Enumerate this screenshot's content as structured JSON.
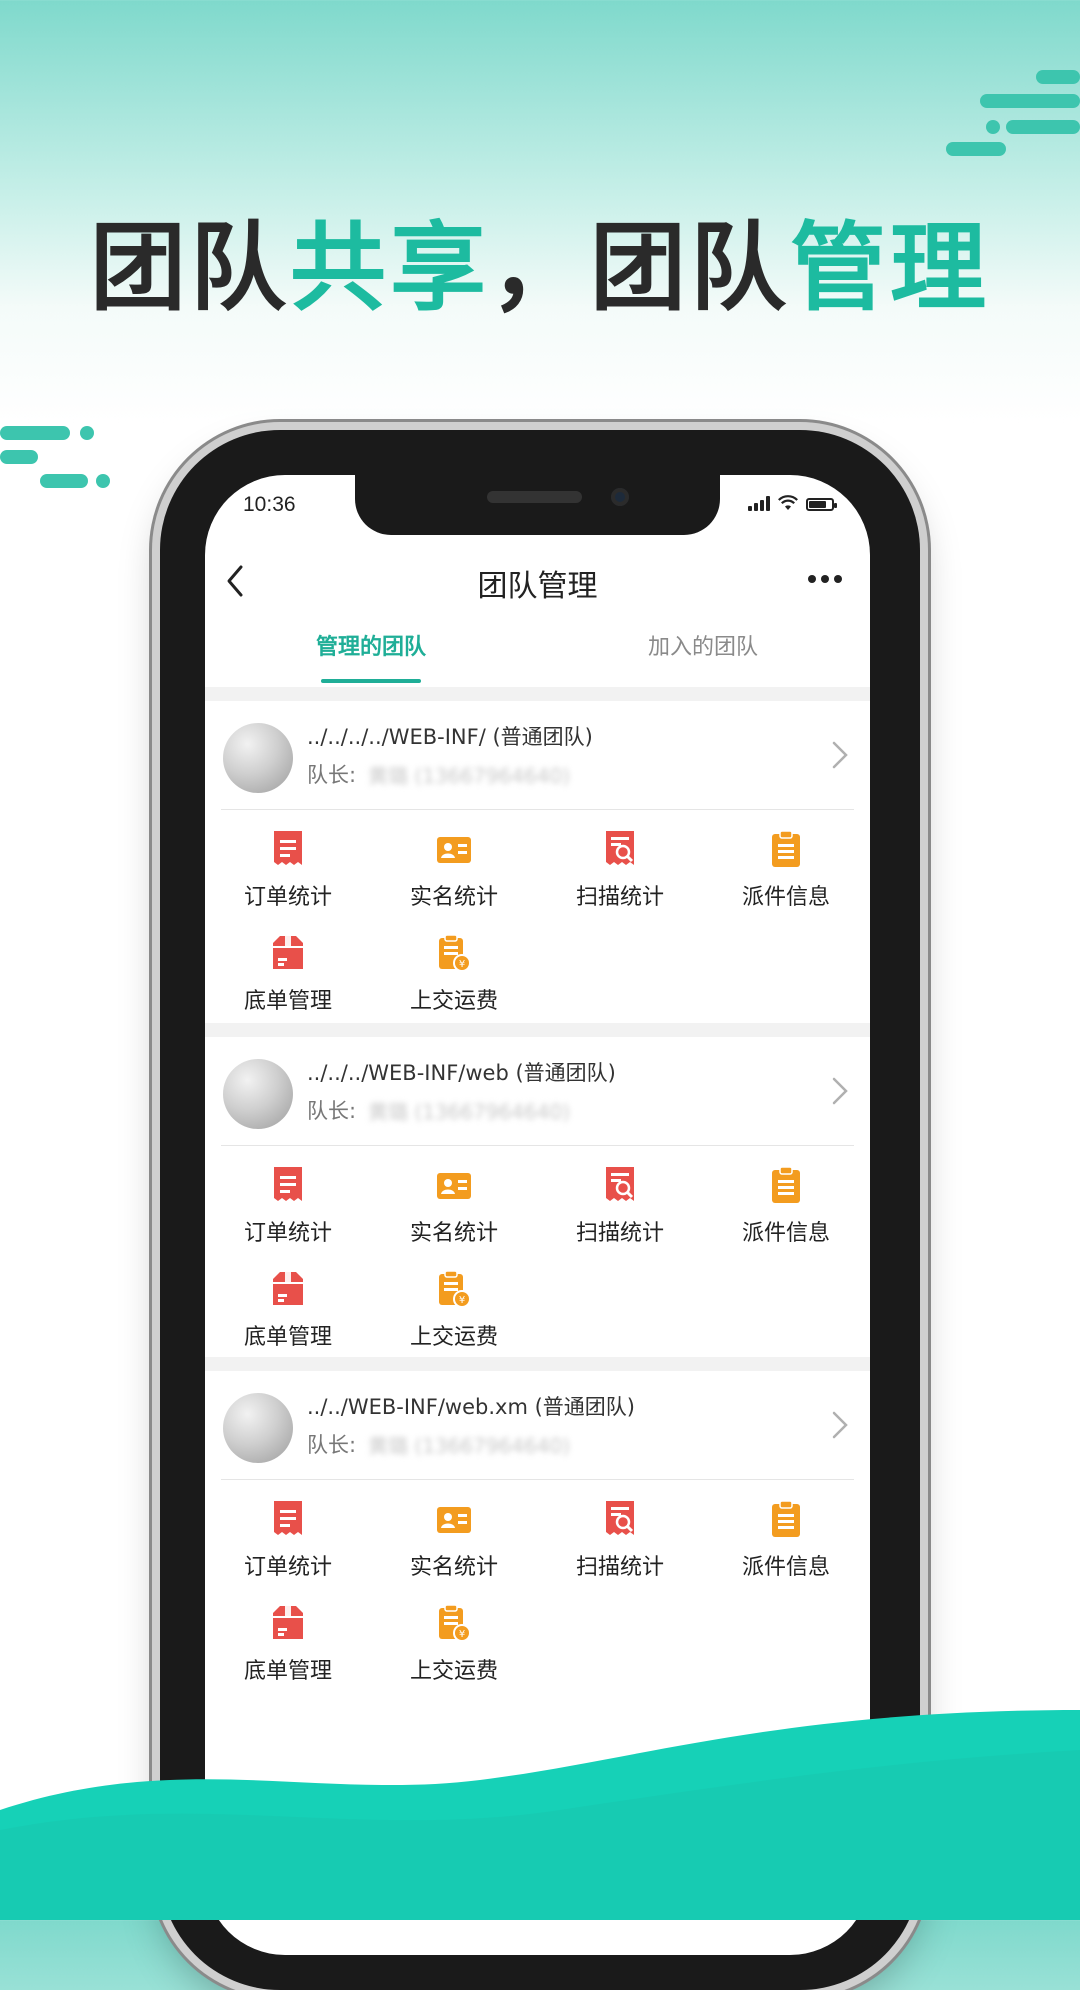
{
  "headline": {
    "part1": "团队",
    "part2": "共享",
    "part3": "，团队",
    "part4": "管理"
  },
  "colors": {
    "accent": "#1dbba0",
    "red_icon": "#e8504a",
    "orange_icon": "#f39c1f",
    "wave": "#19cdb3"
  },
  "status_bar": {
    "time": "10:36"
  },
  "navbar": {
    "title": "团队管理",
    "back_icon": "chevron-left-icon",
    "more_icon": "more-horizontal-icon"
  },
  "tabs": [
    {
      "label": "管理的团队",
      "active": true
    },
    {
      "label": "加入的团队",
      "active": false
    }
  ],
  "teams": [
    {
      "name": "../../../../WEB-INF/ (普通团队)",
      "leader_label": "队长:",
      "leader_value": "黄璐 (13667964640)"
    },
    {
      "name": "../../../WEB-INF/web (普通团队)",
      "leader_label": "队长:",
      "leader_value": "黄璐 (13667964640)"
    },
    {
      "name": "../../WEB-INF/web.xm (普通团队)",
      "leader_label": "队长:",
      "leader_value": "黄璐 (13667964640)"
    }
  ],
  "functions": [
    {
      "label": "订单统计",
      "icon": "order-stats-icon"
    },
    {
      "label": "实名统计",
      "icon": "id-card-icon"
    },
    {
      "label": "扫描统计",
      "icon": "scan-stats-icon"
    },
    {
      "label": "派件信息",
      "icon": "clipboard-icon"
    },
    {
      "label": "底单管理",
      "icon": "package-box-icon"
    },
    {
      "label": "上交运费",
      "icon": "freight-fee-icon"
    }
  ]
}
